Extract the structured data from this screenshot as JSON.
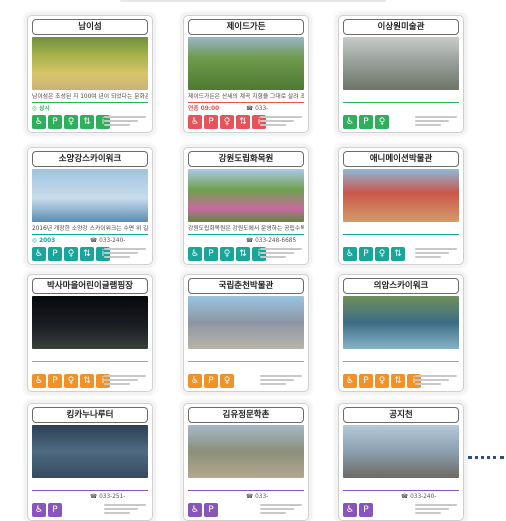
{
  "theme": {
    "red": "#e6545a",
    "green": "#2fae5b",
    "teal": "#1aa59a",
    "orange": "#f0912a",
    "purple": "#8a55b8"
  },
  "cards": [
    {
      "title": "남이섬",
      "desc": "남이섬은 조성된 지 100여 년이 되었다는 문화관광명소",
      "hours": "◎ 상시",
      "phone": "",
      "color": "#2fae5b",
      "icons": [
        "wheelchair-icon",
        "parking-icon",
        "toilet-icon",
        "elevator-icon",
        "info-icon"
      ],
      "scene": "forest"
    },
    {
      "title": "제이드가든",
      "desc": "제이드가든은 산세의 계곡 지형을 그대로 살려 조성한",
      "hours": "연중 09:00",
      "phone": "☎ 033-",
      "color": "#e6545a",
      "icons": [
        "wheelchair-icon",
        "parking-icon",
        "toilet-icon",
        "elevator-icon",
        "info-icon"
      ],
      "scene": "garden"
    },
    {
      "title": "이상원미술관",
      "desc": "",
      "hours": "",
      "phone": "",
      "color": "#2fae5b",
      "icons": [
        "wheelchair-icon",
        "parking-icon",
        "toilet-icon"
      ],
      "scene": "museum"
    },
    {
      "title": "소양강스카이워크",
      "desc": "2016년 개장한 소양강 스카이워크는 수면 위 길",
      "hours": "◎ 2003",
      "phone": "☎ 033-240-",
      "color": "#1aa59a",
      "icons": [
        "wheelchair-icon",
        "parking-icon",
        "toilet-icon",
        "elevator-icon",
        "info-icon"
      ],
      "scene": "bridge"
    },
    {
      "title": "강원도립화목원",
      "desc": "강원도립화목원은 강원도에서 운영하는 공립수목원",
      "hours": "",
      "phone": "☎ 033-248-6685",
      "color": "#1aa59a",
      "icons": [
        "wheelchair-icon",
        "parking-icon",
        "toilet-icon",
        "elevator-icon",
        "info-icon"
      ],
      "scene": "flowers"
    },
    {
      "title": "애니메이션박물관",
      "desc": "",
      "hours": "",
      "phone": "",
      "color": "#1aa59a",
      "icons": [
        "wheelchair-icon",
        "parking-icon",
        "toilet-icon",
        "elevator-icon"
      ],
      "scene": "anim"
    },
    {
      "title": "박사마을어린이글램핑장",
      "desc": "",
      "hours": "",
      "phone": "",
      "color": "#f0912a",
      "icons": [
        "wheelchair-icon",
        "parking-icon",
        "toilet-icon",
        "elevator-icon",
        "info-icon"
      ],
      "scene": "night"
    },
    {
      "title": "국립춘천박물관",
      "desc": "",
      "hours": "",
      "phone": "",
      "color": "#f0912a",
      "icons": [
        "wheelchair-icon",
        "parking-icon",
        "toilet-icon"
      ],
      "scene": "plaza"
    },
    {
      "title": "의암스카이워크",
      "desc": "",
      "hours": "",
      "phone": "",
      "color": "#f0912a",
      "icons": [
        "wheelchair-icon",
        "parking-icon",
        "toilet-icon",
        "elevator-icon",
        "info-icon"
      ],
      "scene": "lake"
    },
    {
      "title": "킹카누나루터",
      "desc": "",
      "hours": "",
      "phone": "☎ 033-251-",
      "color": "#8a55b8",
      "icons": [
        "wheelchair-icon",
        "parking-icon"
      ],
      "scene": "canoe"
    },
    {
      "title": "김유정문학촌",
      "desc": "",
      "hours": "",
      "phone": "☎ 033-",
      "color": "#8a55b8",
      "icons": [
        "wheelchair-icon",
        "parking-icon"
      ],
      "scene": "village"
    },
    {
      "title": "공지천",
      "desc": "",
      "hours": "",
      "phone": "☎ 033-240-",
      "color": "#8a55b8",
      "icons": [
        "wheelchair-icon",
        "parking-icon"
      ],
      "scene": "stream"
    }
  ]
}
